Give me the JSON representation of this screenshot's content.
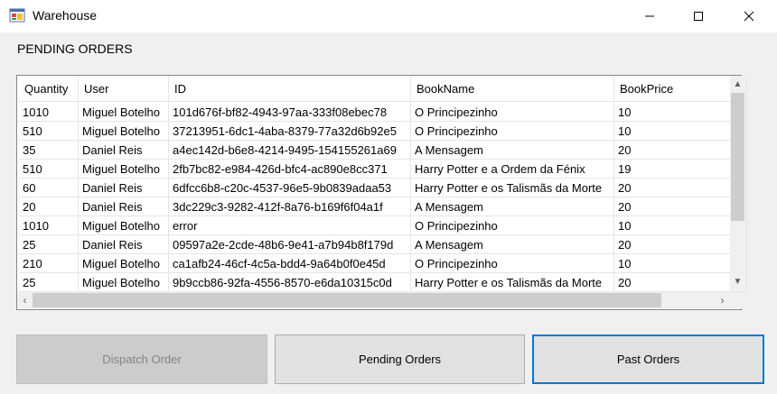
{
  "window": {
    "title": "Warehouse"
  },
  "section_title": "PENDING ORDERS",
  "grid": {
    "columns": [
      "Quantity",
      "User",
      "ID",
      "BookName",
      "BookPrice"
    ],
    "rows": [
      [
        "1010",
        "Miguel Botelho",
        "101d676f-bf82-4943-97aa-333f08ebec78",
        "O Principezinho",
        "10"
      ],
      [
        "510",
        "Miguel Botelho",
        "37213951-6dc1-4aba-8379-77a32d6b92e5",
        "O Principezinho",
        "10"
      ],
      [
        "35",
        "Daniel Reis",
        "a4ec142d-b6e8-4214-9495-154155261a69",
        "A Mensagem",
        "20"
      ],
      [
        "510",
        "Miguel Botelho",
        "2fb7bc82-e984-426d-bfc4-ac890e8cc371",
        "Harry Potter e a Ordem da Fénix",
        "19"
      ],
      [
        "60",
        "Daniel Reis",
        "6dfcc6b8-c20c-4537-96e5-9b0839adaa53",
        "Harry Potter e os Talismãs da Morte",
        "20"
      ],
      [
        "20",
        "Daniel Reis",
        "3dc229c3-9282-412f-8a76-b169f6f04a1f",
        "A Mensagem",
        "20"
      ],
      [
        "1010",
        "Miguel Botelho",
        "error",
        "O Principezinho",
        "10"
      ],
      [
        "25",
        "Daniel Reis",
        "09597a2e-2cde-48b6-9e41-a7b94b8f179d",
        "A Mensagem",
        "20"
      ],
      [
        "210",
        "Miguel Botelho",
        "ca1afb24-46cf-4c5a-bdd4-9a64b0f0e45d",
        "O Principezinho",
        "10"
      ],
      [
        "25",
        "Miguel Botelho",
        "9b9ccb86-92fa-4556-8570-e6da10315c0d",
        "Harry Potter e os Talismãs da Morte",
        "20"
      ]
    ]
  },
  "buttons": {
    "dispatch": "Dispatch Order",
    "pending": "Pending Orders",
    "past": "Past Orders"
  },
  "icons": {
    "app": "app-window-icon",
    "minimize": "minimize-icon",
    "maximize": "maximize-icon",
    "close": "close-icon"
  },
  "colors": {
    "focus_border": "#0078d7",
    "disabled_text": "#838383"
  }
}
